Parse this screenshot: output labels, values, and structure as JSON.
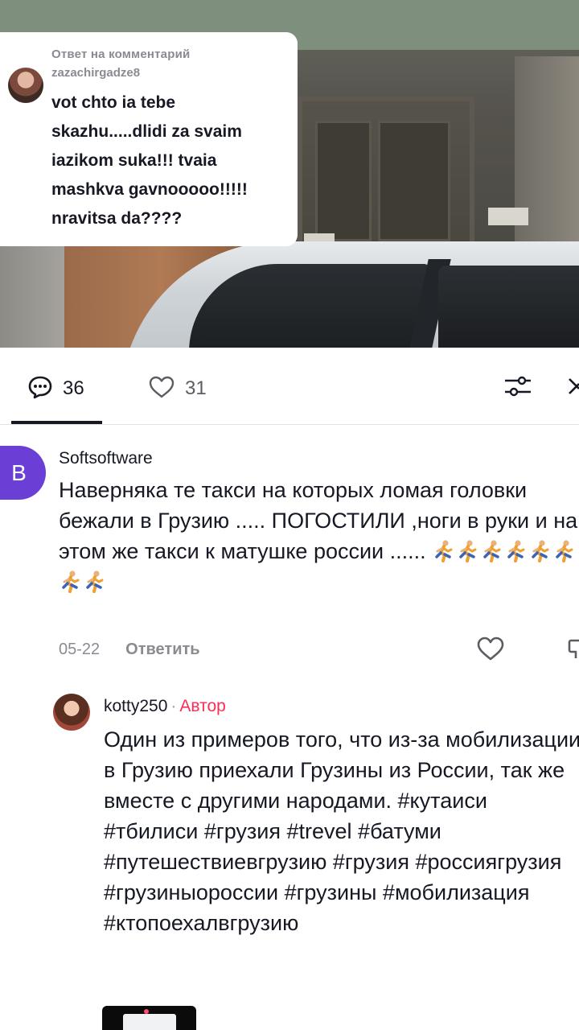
{
  "reply_bubble": {
    "header": "Ответ на комментарий",
    "username": "zazachirgadze8",
    "text_lines": [
      "vot chto ia tebe",
      "skazhu.....dlidi za svaim",
      "iazikom suka!!! tvaia",
      "mashkva gavnooooo!!!!!",
      "nravitsa da????"
    ]
  },
  "actions": {
    "comments_count": "36",
    "likes_count": "31",
    "icons": [
      "comment-icon",
      "heart-icon",
      "filter-icon",
      "close-icon"
    ]
  },
  "comments": [
    {
      "avatar_letter": "B",
      "avatar_color": "#6b3fd6",
      "username": "Softsoftware",
      "text": "Наверняка те такси на которых ломая головки бежали в Грузию ..... ПОГОСТИЛИ ,ноги в руки и на этом же такси к матушке россии ......",
      "emoji_count": 8,
      "date": "05-22",
      "reply_label": "Ответить"
    },
    {
      "username": "kotty250",
      "separator": "·",
      "badge": "Автор",
      "badge_color": "#fe2c55",
      "text": " Один из примеров того, что из-за мобилизации в Грузию приехали Грузины из России, так же вместе с другими народами. #кутаиси #тбилиси #грузия #trevel #батуми #путешествиевгрузию #грузия #россиягрузия #грузиныороссии #грузины #мобилизация #ктопоехалвгрузию"
    }
  ]
}
